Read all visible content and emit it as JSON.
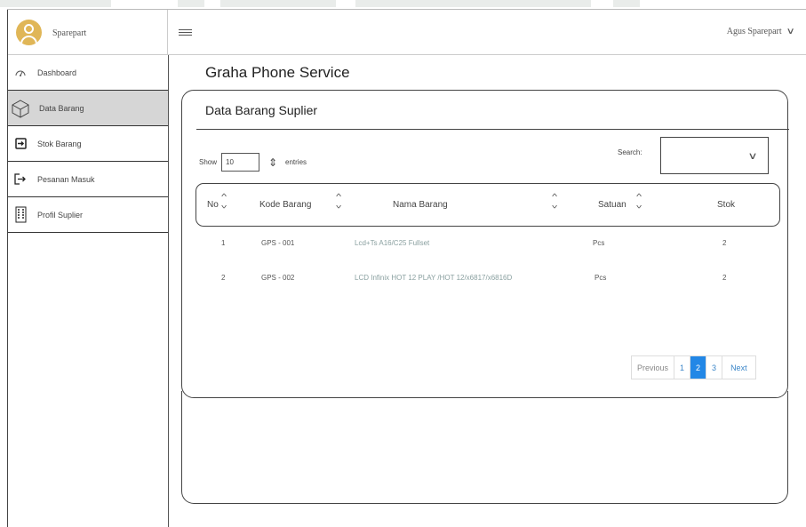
{
  "header": {
    "brand_name": "Sparepart",
    "user_name": "Agus Sparepart",
    "user_chevron": "∨"
  },
  "sidebar": {
    "items": [
      {
        "label": "Dashboard",
        "icon": "dashboard-icon"
      },
      {
        "label": "Data Barang",
        "icon": "box-icon",
        "active": true
      },
      {
        "label": "Stok Barang",
        "icon": "stock-in-icon"
      },
      {
        "label": "Pesanan Masuk",
        "icon": "order-in-icon"
      },
      {
        "label": "Profil Suplier",
        "icon": "building-icon"
      }
    ]
  },
  "main": {
    "page_title": "Graha Phone Service",
    "panel_title": "Data Barang Suplier",
    "show_label": "Show",
    "show_value": "10",
    "entries_label": "entries",
    "search_label": "Search:",
    "search_value": "",
    "columns": {
      "no": "No",
      "kode": "Kode Barang",
      "nama": "Nama Barang",
      "satuan": "Satuan",
      "stok": "Stok"
    },
    "rows": [
      {
        "no": "1",
        "kode": "GPS - 001",
        "nama": "Lcd+Ts A16/C25 Fullset",
        "satuan": "Pcs",
        "stok": "2"
      },
      {
        "no": "2",
        "kode": "GPS - 002",
        "nama": "LCD Infinix HOT 12 PLAY /HOT 12/x6817/x6816D",
        "satuan": "Pcs",
        "stok": "2"
      }
    ],
    "pager": {
      "prev": "Previous",
      "pages": [
        "1",
        "2",
        "3"
      ],
      "current": "2",
      "next": "Next"
    }
  },
  "colors": {
    "accent": "#2287e6",
    "avatar": "#e0b657",
    "active_nav": "#d6d6d6"
  }
}
